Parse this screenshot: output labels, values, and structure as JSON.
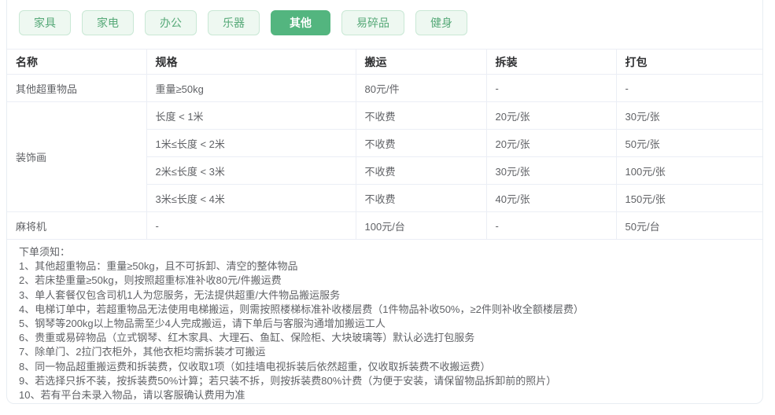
{
  "colors": {
    "accent_green": "#53b57f",
    "tab_inactive_bg": "#eef8f1",
    "tab_inactive_border": "#c9e8d5",
    "tab_inactive_text": "#56a978",
    "table_border": "#ebeef5",
    "header_text": "#303133",
    "body_text": "#606266"
  },
  "tabs": {
    "active_index": 4,
    "items": [
      {
        "label": "家具"
      },
      {
        "label": "家电"
      },
      {
        "label": "办公"
      },
      {
        "label": "乐器"
      },
      {
        "label": "其他"
      },
      {
        "label": "易碎品"
      },
      {
        "label": "健身"
      }
    ]
  },
  "table": {
    "headers": [
      "名称",
      "规格",
      "搬运",
      "拆装",
      "打包"
    ],
    "row_overweight": {
      "name": "其他超重物品",
      "spec": "重量≥50kg",
      "move": "80元/件",
      "disassemble": "-",
      "pack": "-"
    },
    "group_decor": {
      "name": "装饰画",
      "rows": [
        {
          "spec": "长度 < 1米",
          "move": "不收费",
          "disassemble": "20元/张",
          "pack": "30元/张"
        },
        {
          "spec": "1米≤长度 < 2米",
          "move": "不收费",
          "disassemble": "20元/张",
          "pack": "50元/张"
        },
        {
          "spec": "2米≤长度 < 3米",
          "move": "不收费",
          "disassemble": "30元/张",
          "pack": "100元/张"
        },
        {
          "spec": "3米≤长度 < 4米",
          "move": "不收费",
          "disassemble": "40元/张",
          "pack": "150元/张"
        }
      ]
    },
    "row_mahjong": {
      "name": "麻将机",
      "spec": "-",
      "move": "100元/台",
      "disassemble": "-",
      "pack": "50元/台"
    }
  },
  "notes": {
    "title": "下单须知：",
    "items": [
      "1、其他超重物品：重量≥50kg，且不可拆卸、清空的整体物品",
      "2、若床垫重量≥50kg，则按照超重标准补收80元/件搬运费",
      "3、单人套餐仅包含司机1人为您服务，无法提供超重/大件物品搬运服务",
      "4、电梯订单中，若超重物品无法使用电梯搬运，则需按照楼梯标准补收楼层费（1件物品补收50%，≥2件则补收全额楼层费）",
      "5、钢琴等200kg以上物品需至少4人完成搬运，请下单后与客服沟通增加搬运工人",
      "6、贵重或易碎物品（立式钢琴、红木家具、大理石、鱼缸、保险柜、大块玻璃等）默认必选打包服务",
      "7、除单门、2拉门衣柜外，其他衣柜均需拆装才可搬运",
      "8、同一物品超重搬运费和拆装费，仅收取1项（如挂墙电视拆装后依然超重，仅收取拆装费不收搬运费）",
      "9、若选择只拆不装，按拆装费50%计算；若只装不拆，则按拆装费80%计费（为便于安装，请保留物品拆卸前的照片）",
      "10、若有平台未录入物品，请以客服确认费用为准"
    ]
  }
}
